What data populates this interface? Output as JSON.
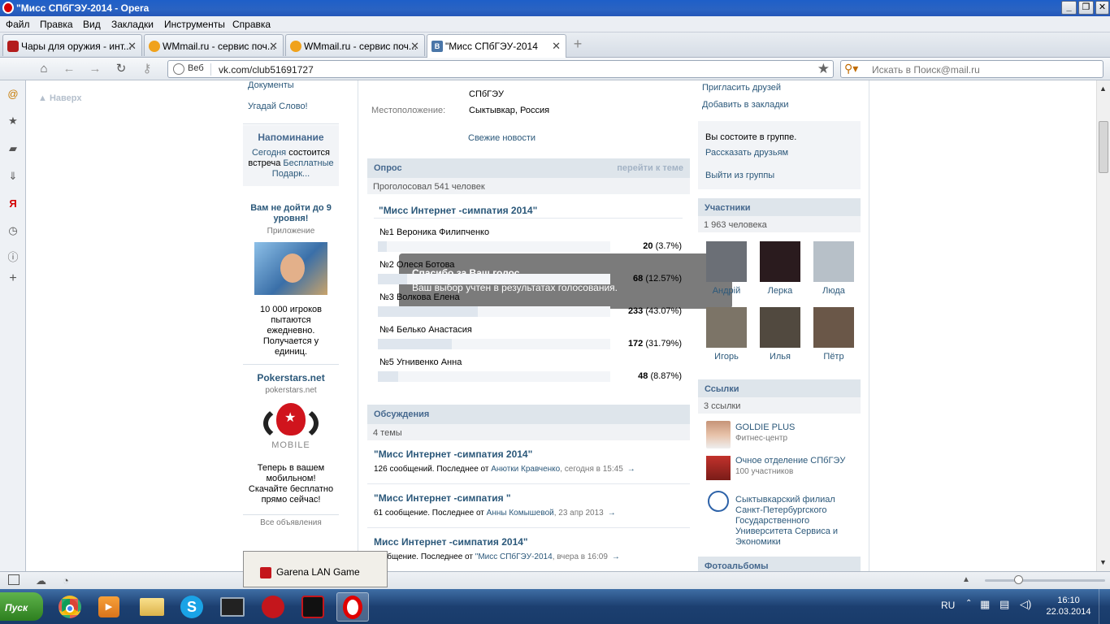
{
  "window": {
    "title": "\"Мисс СПбГЭУ-2014 - Opera"
  },
  "menu": [
    "Файл",
    "Правка",
    "Вид",
    "Закладки",
    "Инструменты",
    "Справка"
  ],
  "tabs": [
    {
      "label": "Чары для оружия - инт...",
      "icon": "sword-icon"
    },
    {
      "label": "WMmail.ru - сервис поч...",
      "icon": "wmmail-icon"
    },
    {
      "label": "WMmail.ru - сервис поч...",
      "icon": "wmmail-icon"
    },
    {
      "label": "\"Мисс СПбГЭУ-2014",
      "icon": "vk-icon"
    }
  ],
  "address": {
    "web_label": "Веб",
    "url": "vk.com/club51691727"
  },
  "search": {
    "placeholder": "Искать в Поиск@mail.ru"
  },
  "left": {
    "nav_up": "Наверх",
    "documents": "Документы",
    "guess_word": "Угадай Слово!",
    "reminder_title": "Напоминание",
    "reminder_today": "Сегодня",
    "reminder_text": " состоится встреча ",
    "reminder_link": "Бесплатные Подарк...",
    "ad1_title": "Вам не дойти до 9 уровня!",
    "ad1_sub": "Приложение",
    "ad1_text": "10 000 игроков пытаются ежедневно. Получается у единиц.",
    "ad2_title": "Pokerstars.net",
    "ad2_sub": "pokerstars.net",
    "ad2_logo": "MOBILE",
    "ad2_text": "Теперь в вашем мобильном! Скачайте бесплатно прямо сейчас!",
    "all_ads": "Все объявления"
  },
  "info": {
    "desc_tail": "СПбГЭУ",
    "location_label": "Местоположение:",
    "location_value": "Сыктывкар, Россия",
    "fresh_news": "Свежие новости"
  },
  "poll": {
    "header": "Опрос",
    "goto": "перейти к теме",
    "voted": "Проголосовал 541 человек",
    "question": "\"Мисс Интернет -симпатия 2014\"",
    "options": [
      {
        "label": "№1 Вероника Филипченко",
        "count": "20",
        "pct": "(3.7%)",
        "fraction": 0.037
      },
      {
        "label": "№2 Олеся Ботова",
        "count": "68",
        "pct": "(12.57%)",
        "fraction": 0.1257
      },
      {
        "label": "№3 Волкова Елена",
        "count": "233",
        "pct": "(43.07%)",
        "fraction": 0.4307
      },
      {
        "label": "№4 Белько Анастасия",
        "count": "172",
        "pct": "(31.79%)",
        "fraction": 0.3179
      },
      {
        "label": "№5 Угнивенко Анна",
        "count": "48",
        "pct": "(8.87%)",
        "fraction": 0.0887
      }
    ]
  },
  "toast": {
    "title": "Спасибо за Ваш голос.",
    "text": "Ваш выбор учтен в результатах голосования."
  },
  "discussions": {
    "header": "Обсуждения",
    "count": "4 темы",
    "items": [
      {
        "title": "\"Мисс Интернет -симпатия 2014\"",
        "meta": "126 сообщений. Последнее от ",
        "author": "Анютки Кравченко",
        "time": ", сегодня в 15:45"
      },
      {
        "title": "\"Мисс Интернет -симпатия \"",
        "meta": "61 сообщение. Последнее от ",
        "author": "Анны Комышевой",
        "time": ", 23 апр 2013"
      },
      {
        "title": "Мисс Интернет -симпатия 2014\"",
        "meta": "сообщение. Последнее от ",
        "author": "\"Мисс СПбГЭУ-2014",
        "time": ", вчера в 16:09"
      }
    ]
  },
  "right": {
    "invite": "Пригласить друзей",
    "bookmark": "Добавить в закладки",
    "member_status": "Вы состоите в группе.",
    "tell_friends": "Рассказать друзьям",
    "leave": "Выйти из группы",
    "members_header": "Участники",
    "members_count": "1 963 человека",
    "members": [
      "Андрій",
      "Лерка",
      "Люда",
      "Игорь",
      "Илья",
      "Пётр"
    ],
    "links_header": "Ссылки",
    "links_count": "3 ссылки",
    "links": [
      {
        "title": "GOLDIE PLUS",
        "sub": "Фитнес-центр"
      },
      {
        "title": "Очное отделение СПбГЭУ",
        "sub": "100 участников"
      },
      {
        "title": "Сыктывкарский филиал Санкт-Петербургского Государственного Университета Сервиса и Экономики",
        "sub": ""
      }
    ],
    "photos_header": "Фотоальбомы"
  },
  "garena": {
    "label": "Garena LAN Game"
  },
  "taskbar": {
    "start": "Пуск",
    "lang": "RU",
    "time": "16:10",
    "date": "22.03.2014"
  }
}
